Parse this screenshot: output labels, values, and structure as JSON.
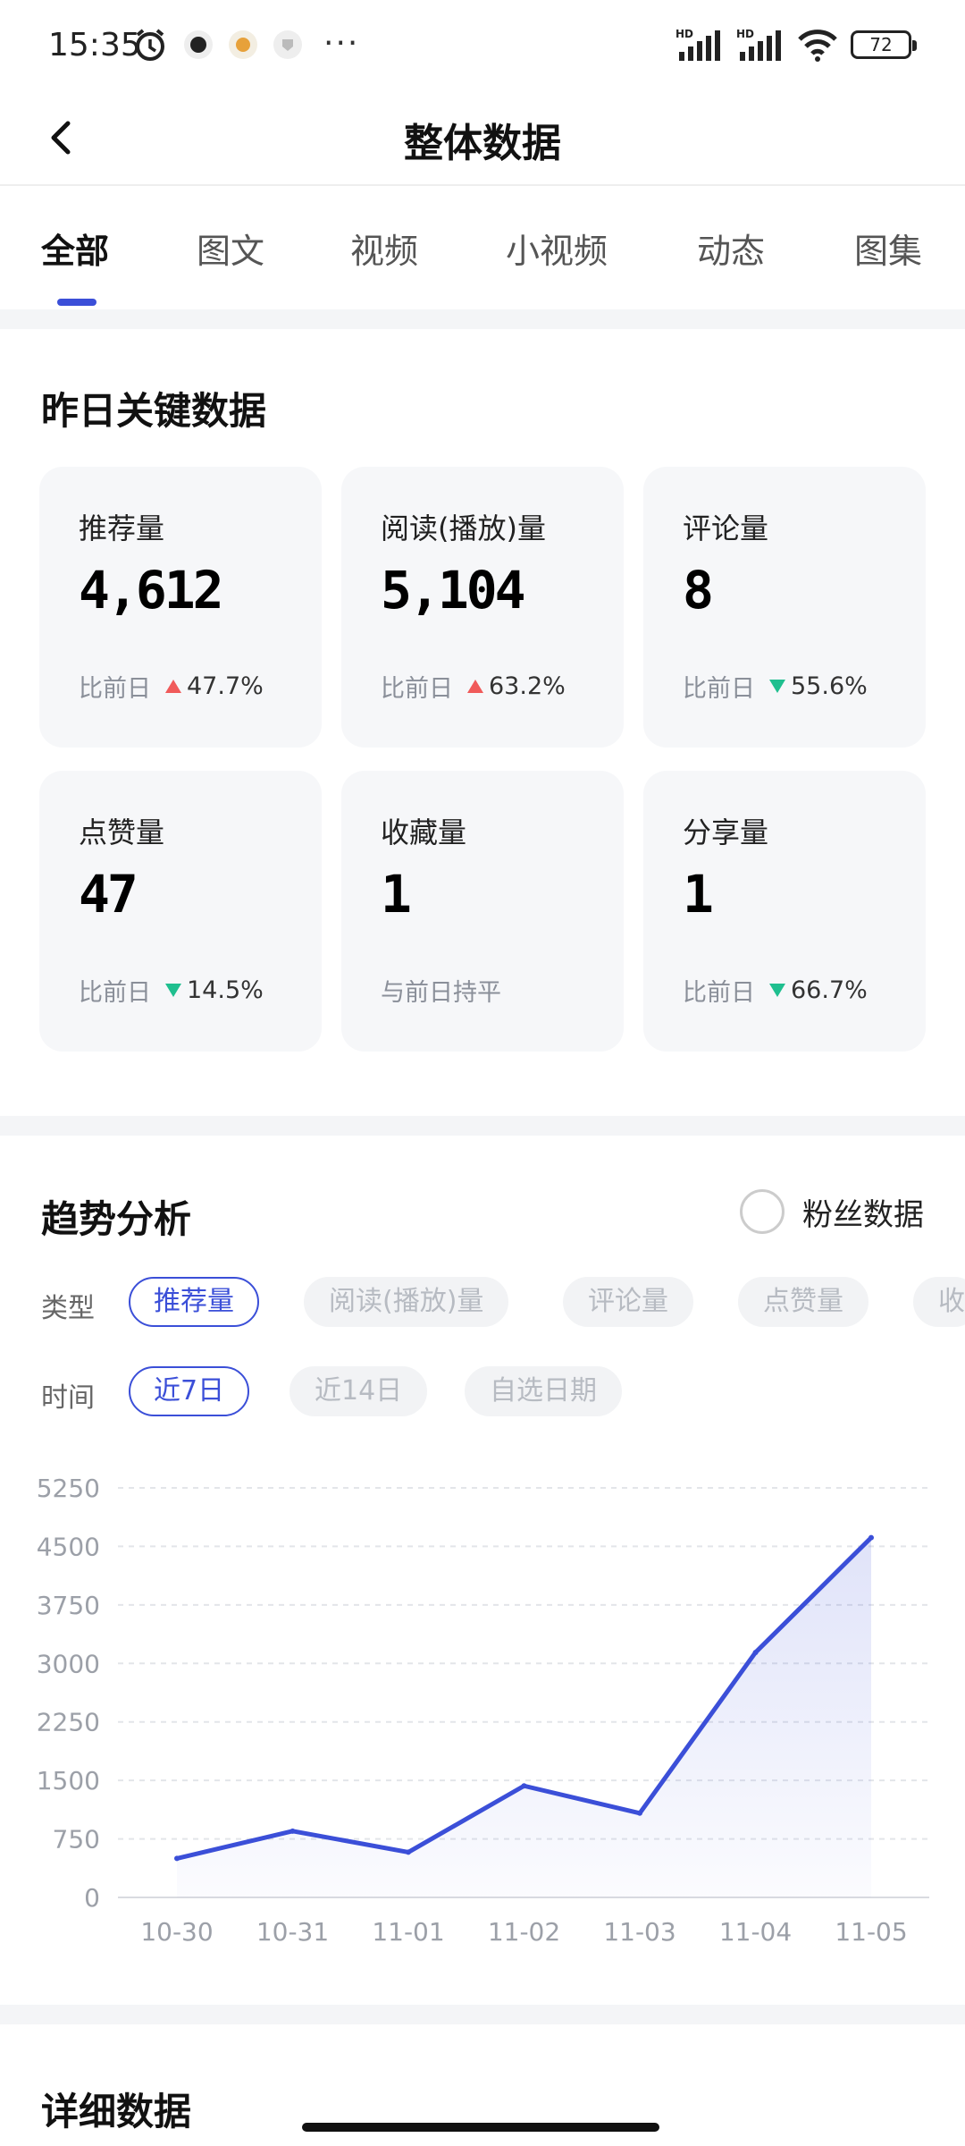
{
  "status_bar": {
    "time": "15:35",
    "battery": "72",
    "signal_label_1": "HD",
    "signal_label_2": "HD"
  },
  "header": {
    "title": "整体数据"
  },
  "tabs": [
    {
      "label": "全部",
      "active": true
    },
    {
      "label": "图文"
    },
    {
      "label": "视频"
    },
    {
      "label": "小视频"
    },
    {
      "label": "动态"
    },
    {
      "label": "图集"
    }
  ],
  "key_data": {
    "title": "昨日关键数据",
    "cards": [
      {
        "label": "推荐量",
        "value": "4,612",
        "compare": "比前日",
        "trend": "up",
        "pct": "47.7%"
      },
      {
        "label": "阅读(播放)量",
        "value": "5,104",
        "compare": "比前日",
        "trend": "up",
        "pct": "63.2%"
      },
      {
        "label": "评论量",
        "value": "8",
        "compare": "比前日",
        "trend": "down",
        "pct": "55.6%"
      },
      {
        "label": "点赞量",
        "value": "47",
        "compare": "比前日",
        "trend": "down",
        "pct": "14.5%"
      },
      {
        "label": "收藏量",
        "value": "1",
        "compare": "与前日持平",
        "trend": "",
        "pct": ""
      },
      {
        "label": "分享量",
        "value": "1",
        "compare": "比前日",
        "trend": "down",
        "pct": "66.7%"
      }
    ]
  },
  "trend": {
    "title": "趋势分析",
    "fans_label": "粉丝数据",
    "type_label": "类型",
    "time_label": "时间",
    "type_chips": [
      "推荐量",
      "阅读(播放)量",
      "评论量",
      "点赞量",
      "收"
    ],
    "time_chips": [
      "近7日",
      "近14日",
      "自选日期"
    ]
  },
  "detail": {
    "title": "详细数据"
  },
  "colors": {
    "accent": "#3b4fd8",
    "up": "#f05a5a",
    "down": "#1fbf8f"
  },
  "chart_data": {
    "type": "area",
    "categories": [
      "10-30",
      "10-31",
      "11-01",
      "11-02",
      "11-03",
      "11-04",
      "11-05"
    ],
    "series": [
      {
        "values": [
          500,
          850,
          580,
          1430,
          1080,
          3140,
          4612
        ]
      }
    ],
    "y_ticks": [
      "0",
      "750",
      "1500",
      "2250",
      "3000",
      "3750",
      "4500",
      "5250"
    ],
    "ylim": [
      0,
      5250
    ],
    "grid": true,
    "line_color": "#3b4fd8"
  }
}
